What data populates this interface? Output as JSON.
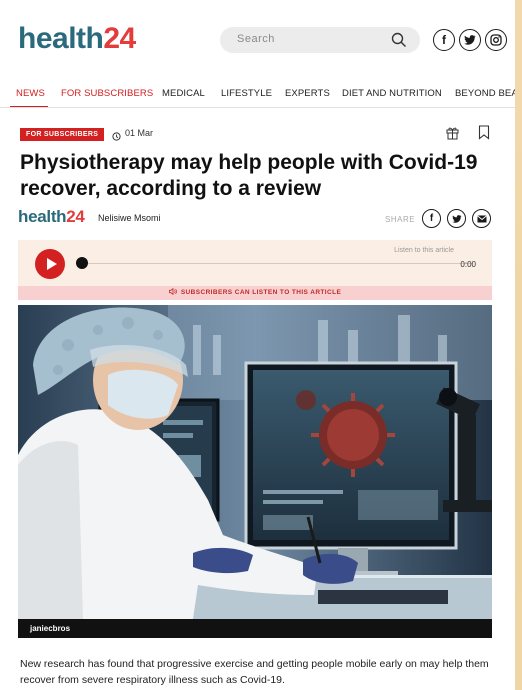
{
  "header": {
    "logo": {
      "part1": "health",
      "part2": "24"
    },
    "search_placeholder": "Search",
    "social": [
      {
        "name": "facebook-icon",
        "glyph": "f"
      },
      {
        "name": "twitter-icon",
        "glyph": "t"
      },
      {
        "name": "instagram-icon",
        "glyph": "◎"
      }
    ]
  },
  "nav": {
    "items": [
      "NEWS",
      "FOR SUBSCRIBERS",
      "MEDICAL",
      "LIFESTYLE",
      "EXPERTS",
      "DIET AND NUTRITION",
      "BEYOND BEA"
    ]
  },
  "article": {
    "badge": "FOR SUBSCRIBERS",
    "date": "01 Mar",
    "title": "Physiotherapy may help people with Covid-19 recover, according to a review",
    "byline_logo": {
      "part1": "health",
      "part2": "24"
    },
    "author": "Nelisiwe Msomi",
    "share_label": "SHARE",
    "audio": {
      "listen_label": "Listen to this article",
      "time": "0:00",
      "subscribers_notice": "SUBSCRIBERS CAN LISTEN TO THIS ARTICLE"
    },
    "image_caption": "janiecbros",
    "body": "New research has found that progressive exercise and getting people mobile early on may help them recover from severe respiratory illness such as Covid-19."
  },
  "colors": {
    "brand_teal": "#2b6a7c",
    "brand_red": "#e23c3c",
    "accent_red": "#d32020"
  }
}
